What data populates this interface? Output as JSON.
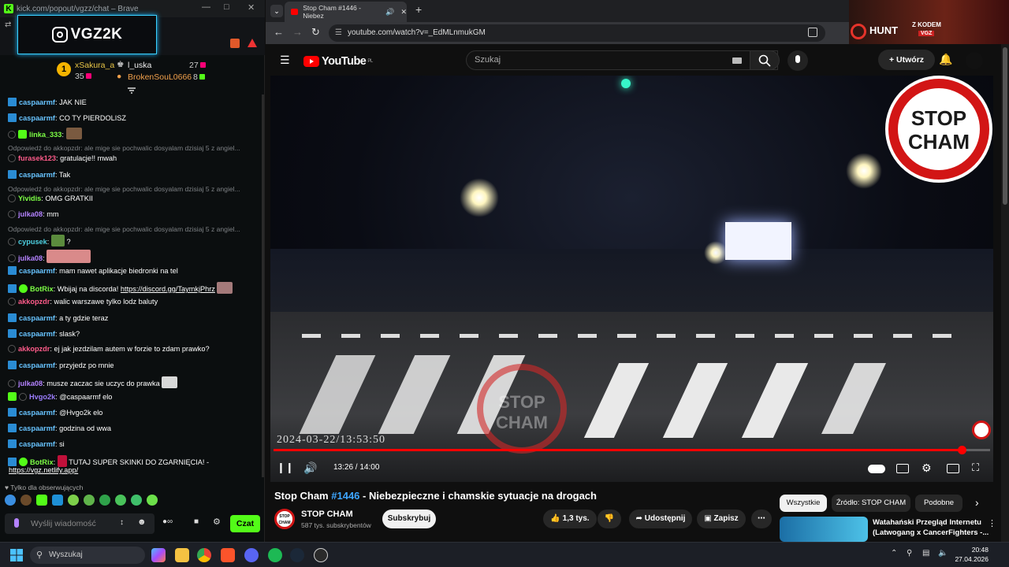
{
  "chat_window": {
    "title": "kick.com/popout/vgzz/chat – Brave",
    "banner": "VGZ2K",
    "leaderboard": {
      "rank": "1",
      "entries": [
        {
          "name": "xSakura_a",
          "count": "35"
        },
        {
          "name": "l_uska",
          "count": "27"
        },
        {
          "name": "BrokenSouL0666",
          "count": "8"
        }
      ]
    },
    "messages": [
      {
        "user": "caspaarmf",
        "text": "JAK NIE"
      },
      {
        "user": "caspaarmf",
        "text": "CO TY PIERDOLISZ"
      },
      {
        "user": "linka_333",
        "text": ""
      },
      {
        "reply": "Odpowiedź do akkopzdr: ale mige sie pochwalic dosyalam dzisiaj 5 z angiel...",
        "user": "furasek123",
        "text": "gratulacje!! mwah"
      },
      {
        "user": "caspaarmf",
        "text": "Tak"
      },
      {
        "reply": "Odpowiedź do akkopzdr: ale mige sie pochwalic dosyalam dzisiaj 5 z angiel...",
        "user": "Yividis",
        "text": "OMG GRATKII"
      },
      {
        "user": "julka08",
        "text": "mm"
      },
      {
        "reply": "Odpowiedź do akkopzdr: ale mige sie pochwalic dosyalam dzisiaj 5 z angiel...",
        "user": "cypusek",
        "text": "?"
      },
      {
        "user": "julka08",
        "text": ""
      },
      {
        "user": "caspaarmf",
        "text": "mam nawet aplikacje biedronki na tel"
      },
      {
        "user": "BotRix",
        "text": "Wbijaj na discorda!",
        "link": "https://discord.gg/TaymkjPhrz"
      },
      {
        "user": "akkopzdr",
        "text": "walic warszawe tylko lodz baluty"
      },
      {
        "user": "caspaarmf",
        "text": "a ty gdzie teraz"
      },
      {
        "user": "caspaarmf",
        "text": "slask?"
      },
      {
        "user": "akkopzdr",
        "text": "ej jak jezdzilam autem w forzie to zdam prawko?"
      },
      {
        "user": "caspaarmf",
        "text": "przyjedz po mnie"
      },
      {
        "user": "julka08",
        "text": "musze zaczac sie uczyc do prawka"
      },
      {
        "user": "Hvgo2k",
        "text": "@caspaarmf elo"
      },
      {
        "user": "caspaarmf",
        "text": "@Hvgo2k elo"
      },
      {
        "user": "caspaarmf",
        "text": "godzina od wwa"
      },
      {
        "user": "caspaarmf",
        "text": "si"
      },
      {
        "user": "BotRix",
        "text": "TUTAJ SUPER SKINKI DO ZGARNIĘCIA! -",
        "link": "https://vgz.netlify.app/"
      }
    ],
    "followers_only": "Tylko dla obserwujących",
    "input_placeholder": "Wyślij wiadomość",
    "send_label": "Czat"
  },
  "browser": {
    "tab_title": "Stop Cham #1446 - Niebez",
    "url": "youtube.com/watch?v=_EdMLnmukGM",
    "banner_text": "HUNT",
    "banner_code": "Z KODEM",
    "banner_code_value": "VGZ"
  },
  "youtube": {
    "logo": "YouTube",
    "region": "PL",
    "search_placeholder": "Szukaj",
    "create_label": "Utwórz",
    "video": {
      "stop_sign_line1": "STOP",
      "stop_sign_line2": "CHAM",
      "timestamp": "2024-03-22/13:53:50",
      "current_time": "13:26",
      "duration": "14:00",
      "time_display": "13:26 / 14:00",
      "progress": 0.96
    },
    "title_prefix": "Stop Cham",
    "title_episode": "#1446",
    "title_suffix": "- Niebezpieczne i chamskie sytuacje na drogach",
    "channel": "STOP CHAM",
    "subscribers": "587 tys. subskrybentów",
    "subscribe_label": "Subskrybuj",
    "likes": "1,3 tys.",
    "share_label": "Udostępnij",
    "save_label": "Zapisz",
    "chips": [
      "Wszystkie",
      "Źródło: STOP CHAM",
      "Podobne"
    ],
    "recommendation_title": "Watahański Przegląd Internetu (Latwogang x CancerFighters -..."
  },
  "taskbar": {
    "search_label": "Wyszukaj",
    "time": "20:48",
    "date": "27.04.2026"
  }
}
